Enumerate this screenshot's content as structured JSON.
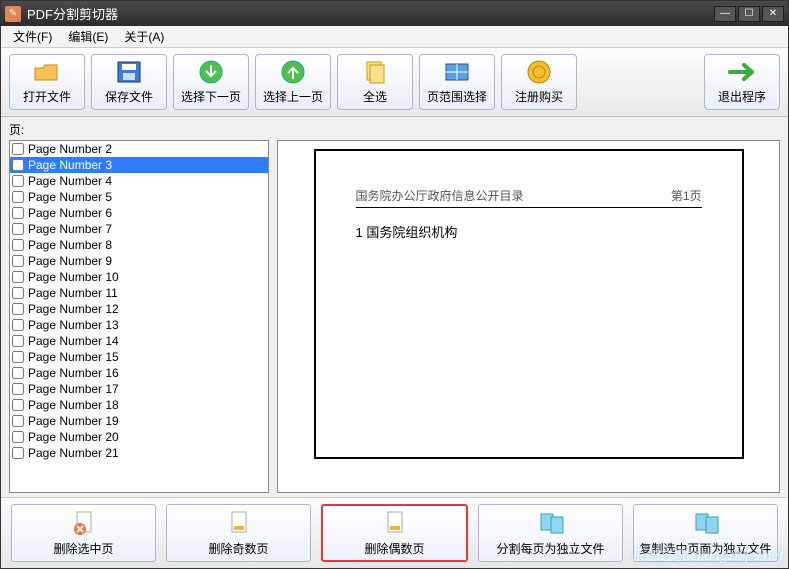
{
  "window": {
    "title": "PDF分割剪切器"
  },
  "menubar": {
    "file": "文件(F)",
    "edit": "编辑(E)",
    "about": "关于(A)"
  },
  "toolbar": {
    "open": "打开文件",
    "save": "保存文件",
    "next": "选择下一页",
    "prev": "选择上一页",
    "all": "全选",
    "range": "页范围选择",
    "buy": "注册购买",
    "exit": "退出程序"
  },
  "pages_label": "页:",
  "pages": [
    {
      "label": "Page Number 2",
      "selected": false
    },
    {
      "label": "Page Number 3",
      "selected": true
    },
    {
      "label": "Page Number 4",
      "selected": false
    },
    {
      "label": "Page Number 5",
      "selected": false
    },
    {
      "label": "Page Number 6",
      "selected": false
    },
    {
      "label": "Page Number 7",
      "selected": false
    },
    {
      "label": "Page Number 8",
      "selected": false
    },
    {
      "label": "Page Number 9",
      "selected": false
    },
    {
      "label": "Page Number 10",
      "selected": false
    },
    {
      "label": "Page Number 11",
      "selected": false
    },
    {
      "label": "Page Number 12",
      "selected": false
    },
    {
      "label": "Page Number 13",
      "selected": false
    },
    {
      "label": "Page Number 14",
      "selected": false
    },
    {
      "label": "Page Number 15",
      "selected": false
    },
    {
      "label": "Page Number 16",
      "selected": false
    },
    {
      "label": "Page Number 17",
      "selected": false
    },
    {
      "label": "Page Number 18",
      "selected": false
    },
    {
      "label": "Page Number 19",
      "selected": false
    },
    {
      "label": "Page Number 20",
      "selected": false
    },
    {
      "label": "Page Number 21",
      "selected": false
    }
  ],
  "preview": {
    "header_left": "国务院办公厅政府信息公开目录",
    "header_right": "第1页",
    "heading": "1  国务院组织机构"
  },
  "bottombar": {
    "del_selected": "删除选中页",
    "del_odd": "删除奇数页",
    "del_even": "删除偶数页",
    "split_each": "分割每页为独立文件",
    "copy_selected": "复制选中页面为独立文件"
  },
  "watermark": "系统之家 xitongzhijia.net"
}
